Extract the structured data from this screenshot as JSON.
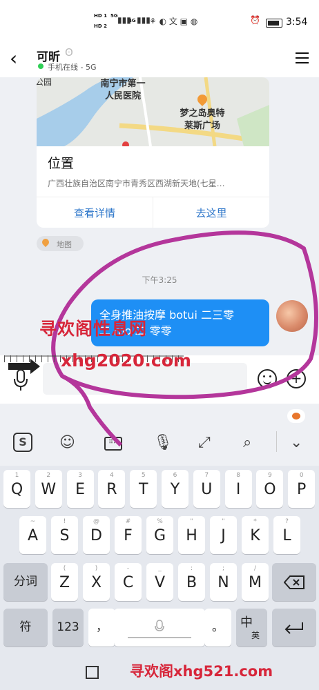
{
  "status_bar": {
    "left_badges": [
      "HD 1",
      "HD 2"
    ],
    "network": [
      "5G",
      "4G"
    ],
    "time": "3:54"
  },
  "header": {
    "contact_name": "可昕",
    "online_status": "手机在线 - 5G",
    "icons": [
      "back-icon",
      "ear-icon",
      "menu-icon"
    ]
  },
  "location_card": {
    "map_labels": [
      "公园",
      "南宁市第一\n人民医院",
      "梦之岛奥特\n莱斯广场"
    ],
    "title": "位置",
    "address": "广西壮族自治区南宁市青秀区西湖新天地(七星…",
    "view_button": "查看详情",
    "go_button": "去这里",
    "map_tag": "地图"
  },
  "timestamp": "下午3:25",
  "message": {
    "text": "全身推油按摩 botui 二三零\n二 mo 二 零零"
  },
  "input_bar": {
    "placeholder": ""
  },
  "keyboard": {
    "row1": [
      {
        "m": "Q",
        "s": "1"
      },
      {
        "m": "W",
        "s": "2"
      },
      {
        "m": "E",
        "s": "3"
      },
      {
        "m": "R",
        "s": "4"
      },
      {
        "m": "T",
        "s": "5"
      },
      {
        "m": "Y",
        "s": "6"
      },
      {
        "m": "U",
        "s": "7"
      },
      {
        "m": "I",
        "s": "8"
      },
      {
        "m": "O",
        "s": "9"
      },
      {
        "m": "P",
        "s": "0"
      }
    ],
    "row2": [
      {
        "m": "A",
        "s": "~"
      },
      {
        "m": "S",
        "s": "!"
      },
      {
        "m": "D",
        "s": "@"
      },
      {
        "m": "F",
        "s": "#"
      },
      {
        "m": "G",
        "s": "%"
      },
      {
        "m": "H",
        "s": "\""
      },
      {
        "m": "J",
        "s": "\""
      },
      {
        "m": "K",
        "s": "*"
      },
      {
        "m": "L",
        "s": "?"
      }
    ],
    "row3": [
      {
        "m": "Z",
        "s": "("
      },
      {
        "m": "X",
        "s": ")"
      },
      {
        "m": "C",
        "s": "-"
      },
      {
        "m": "V",
        "s": "_"
      },
      {
        "m": "B",
        "s": ":"
      },
      {
        "m": "N",
        "s": ";"
      },
      {
        "m": "M",
        "s": "/"
      }
    ],
    "fenci": "分词",
    "fu": "符",
    "num": "123",
    "comma": "，",
    "period": "。",
    "zh": "中",
    "en": "英"
  },
  "watermarks": {
    "cn": "寻欢阁性息网",
    "site1": "xhg2020.com",
    "site2": "寻欢阁xhg521.com"
  }
}
